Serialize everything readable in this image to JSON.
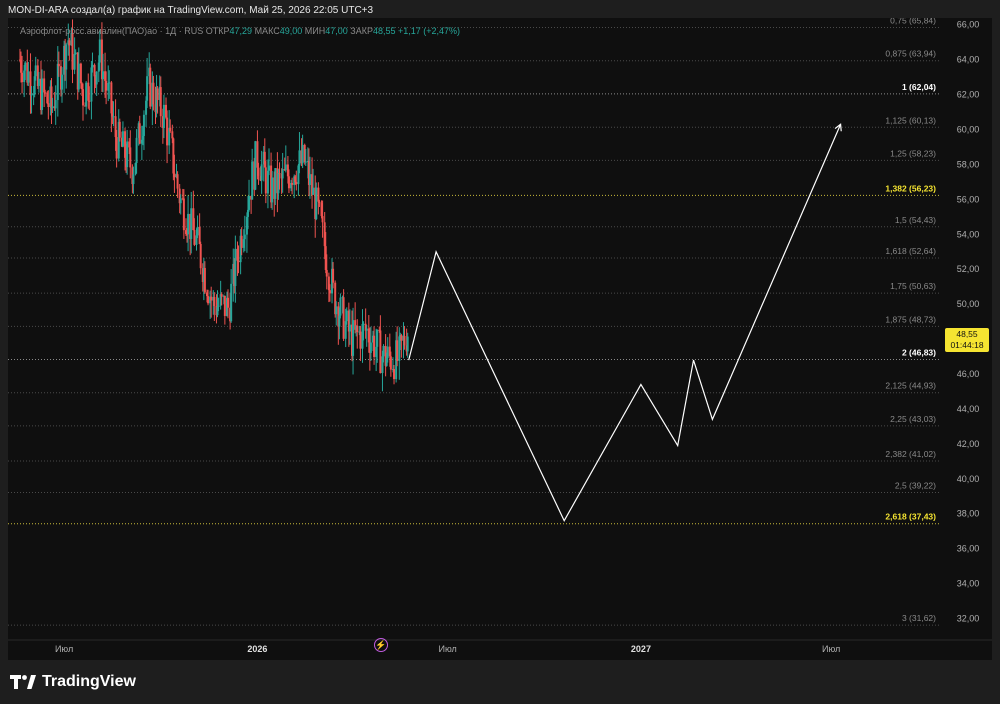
{
  "header": {
    "text": "MON-DI-ARA создал(а) график на TradingView.com, Май 25, 2026 22:05 UTC+3"
  },
  "symbol": {
    "name": "Аэрофлот-росс.авиалин(ПАО)ао · 1Д · RUS",
    "open_label": "ОТКР",
    "open_value": "47,29",
    "high_label": "МАКС",
    "high_value": "49,00",
    "low_label": "МИН",
    "low_value": "47,00",
    "close_label": "ЗАКР",
    "close_value": "48,55",
    "change": "+1,17 (+2,47%)"
  },
  "price_tag": {
    "price": "48,55",
    "countdown": "01:44:18"
  },
  "footer": {
    "brand": "TradingView"
  },
  "colors": {
    "background": "#0f0f0f",
    "up_candle": "#26a69a",
    "down_candle": "#ef5350",
    "projection": "#ffffff",
    "highlight_level": "#f5e431",
    "price_tag": "#f5e431"
  },
  "chart_data": {
    "type": "line",
    "instrument": "Аэрофлот-росс.авиалин(ПАО)ао",
    "interval": "1Д",
    "y_axis": {
      "side": "right",
      "ylim": [
        31,
        66.5
      ],
      "ticks": [
        32,
        34,
        36,
        38,
        40,
        42,
        44,
        46,
        48,
        50,
        52,
        54,
        56,
        58,
        60,
        62,
        64,
        66
      ],
      "tick_labels": [
        "32,00",
        "34,00",
        "36,00",
        "38,00",
        "40,00",
        "42,00",
        "44,00",
        "46,00",
        "48,00",
        "50,00",
        "52,00",
        "54,00",
        "56,00",
        "58,00",
        "60,00",
        "62,00",
        "64,00",
        "66,00"
      ]
    },
    "x_axis": {
      "ticks": [
        "2025-07-01",
        "2026-01-01",
        "2026-07-01",
        "2027-01-01",
        "2027-07-01"
      ],
      "tick_labels": [
        "Июл",
        "2026",
        "Июл",
        "2027",
        "Июл"
      ]
    },
    "fib_levels": [
      {
        "ratio": "0,75",
        "price": 65.84,
        "label": "0,75 (65,84)",
        "style": "muted"
      },
      {
        "ratio": "0,875",
        "price": 63.94,
        "label": "0,875 (63,94)",
        "style": "muted"
      },
      {
        "ratio": "1",
        "price": 62.04,
        "label": "1 (62,04)",
        "style": "bold"
      },
      {
        "ratio": "1,125",
        "price": 60.13,
        "label": "1,125 (60,13)",
        "style": "muted"
      },
      {
        "ratio": "1,25",
        "price": 58.23,
        "label": "1,25 (58,23)",
        "style": "muted"
      },
      {
        "ratio": "1,382",
        "price": 56.23,
        "label": "1,382 (56,23)",
        "style": "highlight"
      },
      {
        "ratio": "1,5",
        "price": 54.43,
        "label": "1,5 (54,43)",
        "style": "muted"
      },
      {
        "ratio": "1,618",
        "price": 52.64,
        "label": "1,618 (52,64)",
        "style": "muted"
      },
      {
        "ratio": "1,75",
        "price": 50.63,
        "label": "1,75 (50,63)",
        "style": "muted"
      },
      {
        "ratio": "1,875",
        "price": 48.73,
        "label": "1,875 (48,73)",
        "style": "muted"
      },
      {
        "ratio": "2",
        "price": 46.83,
        "label": "2 (46,83)",
        "style": "bold"
      },
      {
        "ratio": "2,125",
        "price": 44.93,
        "label": "2,125 (44,93)",
        "style": "muted"
      },
      {
        "ratio": "2,25",
        "price": 43.03,
        "label": "2,25 (43,03)",
        "style": "muted"
      },
      {
        "ratio": "2,382",
        "price": 41.02,
        "label": "2,382 (41,02)",
        "style": "muted"
      },
      {
        "ratio": "2,5",
        "price": 39.22,
        "label": "2,5 (39,22)",
        "style": "muted"
      },
      {
        "ratio": "2,618",
        "price": 37.43,
        "label": "2,618 (37,43)",
        "style": "highlight"
      },
      {
        "ratio": "3",
        "price": 31.62,
        "label": "3 (31,62)",
        "style": "muted"
      }
    ],
    "price_path": {
      "description_dates": [
        "2025-05-20",
        "2025-06-05",
        "2025-06-20",
        "2025-07-05",
        "2025-07-20",
        "2025-08-05",
        "2025-08-20",
        "2025-09-05",
        "2025-09-20",
        "2025-10-05",
        "2025-10-20",
        "2025-11-05",
        "2025-11-20",
        "2025-12-05",
        "2025-12-20",
        "2026-01-01",
        "2026-01-15",
        "2026-02-01",
        "2026-02-15",
        "2026-03-01",
        "2026-03-15",
        "2026-04-01",
        "2026-04-15",
        "2026-05-01",
        "2026-05-15",
        "2026-05-25"
      ],
      "close": [
        64.0,
        62.5,
        61.2,
        65.3,
        62.0,
        64.2,
        59.5,
        57.8,
        62.5,
        60.8,
        56.0,
        53.5,
        50.0,
        49.8,
        55.0,
        58.5,
        56.5,
        57.5,
        58.2,
        55.0,
        50.5,
        48.0,
        48.5,
        47.0,
        46.8,
        48.55
      ]
    },
    "projection": {
      "color": "#ffffff",
      "x": [
        "2026-05-25",
        "2026-06-20",
        "2026-10-20",
        "2027-01-01",
        "2027-02-05",
        "2027-02-20",
        "2027-03-10",
        "2027-07-10"
      ],
      "y": [
        46.8,
        53.0,
        37.6,
        45.4,
        41.9,
        46.8,
        43.4,
        60.3
      ]
    },
    "last_price": 48.55
  }
}
